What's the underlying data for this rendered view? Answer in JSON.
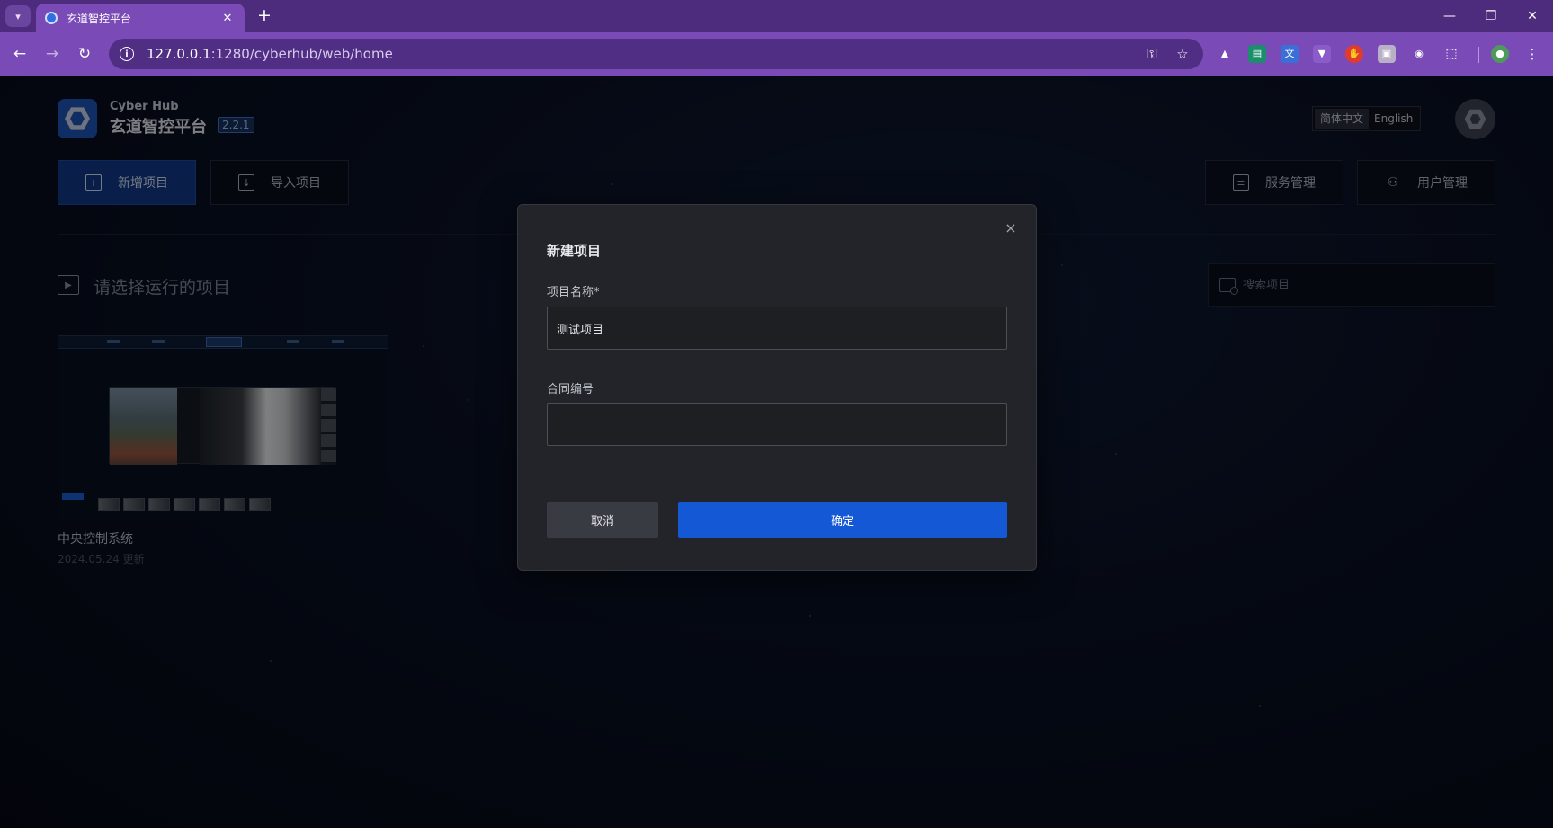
{
  "browser": {
    "tab_title": "玄道智控平台",
    "tab_close": "✕",
    "new_tab": "+",
    "window_controls": {
      "minimize": "—",
      "restore": "❐",
      "close": "✕"
    },
    "url_host": "127.0.0.1",
    "url_path": ":1280/cyberhub/web/home",
    "tab_bg": "#4d2c7e",
    "toolbar_bg": "#7a4bb7",
    "icons": [
      "menu-icon",
      "back-icon",
      "forward-icon",
      "reload-icon",
      "info-icon",
      "key-icon",
      "star-icon",
      "extensions-icon",
      "profile-icon",
      "more-icon"
    ]
  },
  "header": {
    "brand_en": "Cyber Hub",
    "brand_cn": "玄道智控平台",
    "version": "2.2.1",
    "lang_zh": "简体中文",
    "lang_en": "English"
  },
  "actions": {
    "new_project": "新增项目",
    "import_project": "导入项目",
    "service_manage": "服务管理",
    "user_manage": "用户管理"
  },
  "main": {
    "section_title": "请选择运行的项目",
    "search_placeholder": "搜索项目",
    "projects": [
      {
        "title": "中央控制系统",
        "updated": "2024.05.24 更新"
      }
    ]
  },
  "modal": {
    "title": "新建项目",
    "close": "×",
    "name_label": "项目名称*",
    "name_value": "测试项目",
    "contract_label": "合同编号",
    "contract_value": "",
    "cancel": "取消",
    "confirm": "确定",
    "accent": "#1558d6"
  }
}
